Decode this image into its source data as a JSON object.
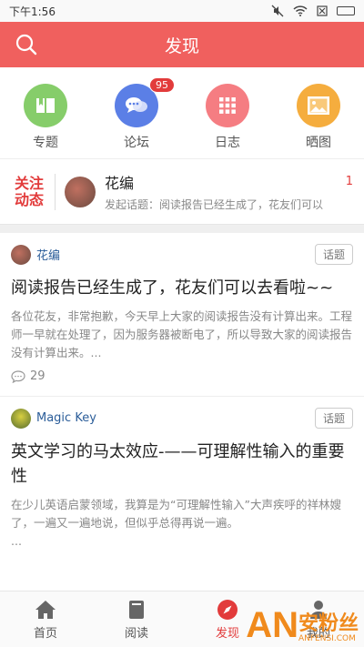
{
  "status": {
    "time": "下午1:56"
  },
  "header": {
    "title": "发现"
  },
  "icons": [
    {
      "label": "专题",
      "color": "#86cd6a",
      "icon": "book-icon"
    },
    {
      "label": "论坛",
      "color": "#5b7fe6",
      "icon": "chat-icon",
      "badge": "95"
    },
    {
      "label": "日志",
      "color": "#f57d82",
      "icon": "grid-icon"
    },
    {
      "label": "晒图",
      "color": "#f5ad3e",
      "icon": "image-icon"
    }
  ],
  "follow": {
    "tag_line1": "关注",
    "tag_line2": "动态",
    "name": "花编",
    "subtitle": "发起话题：阅读报告已经生成了，花友们可以",
    "count": "1"
  },
  "posts": [
    {
      "author": "花编",
      "tag": "话题",
      "title": "阅读报告已经生成了，花友们可以去看啦~~",
      "excerpt": "各位花友，非常抱歉，今天早上大家的阅读报告没有计算出来。工程师一早就在处理了，因为服务器被断电了，所以导致大家的阅读报告没有计算出来。...",
      "comments": "29"
    },
    {
      "author": "Magic Key",
      "tag": "话题",
      "title": "英文学习的马太效应-——可理解性输入的重要性",
      "excerpt": "在少儿英语启蒙领域，我算是为“可理解性输入”大声疾呼的祥林嫂了，一遍又一遍地说，但似乎总得再说一遍。",
      "ellipsis": "..."
    }
  ],
  "tabs": [
    {
      "label": "首页",
      "icon": "home-icon"
    },
    {
      "label": "阅读",
      "icon": "book-icon"
    },
    {
      "label": "发现",
      "icon": "compass-icon",
      "active": true
    },
    {
      "label": "我的",
      "icon": "person-icon"
    }
  ],
  "watermark": {
    "big": "AN",
    "text": "安粉丝",
    "url": "ANFENSI.COM"
  }
}
